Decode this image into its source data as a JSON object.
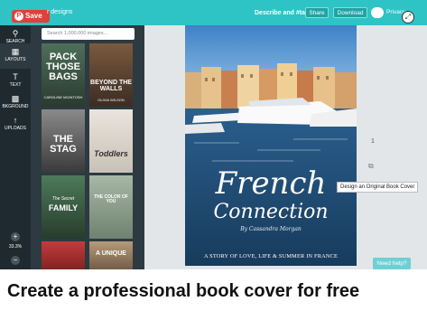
{
  "header": {
    "save_label": "Save",
    "designs_link": "r designs",
    "describe_label": "Describe and #tag",
    "share_label": "Share",
    "download_label": "Download",
    "privacy_label": "Privacy",
    "accent_color": "#2ec4c6",
    "save_color": "#e0403b"
  },
  "sidebar": {
    "items": [
      {
        "label": "SEARCH",
        "icon": "search-icon"
      },
      {
        "label": "LAYOUTS",
        "icon": "layouts-icon"
      },
      {
        "label": "TEXT",
        "icon": "text-icon"
      },
      {
        "label": "BKGROUND",
        "icon": "background-icon"
      },
      {
        "label": "UPLOADS",
        "icon": "upload-icon"
      }
    ],
    "zoom_level": "33.3%"
  },
  "panel": {
    "search_placeholder": "Search 1,000,000 images...",
    "thumbnails": [
      {
        "title": "PACK THOSE BAGS",
        "subtitle": "CAROLINE MCINTOSH"
      },
      {
        "title": "BEYOND THE WALLS",
        "subtitle": "OLIVIA WILSON"
      },
      {
        "title": "THE STAG",
        "subtitle": ""
      },
      {
        "title": "Toddlers",
        "subtitle": ""
      },
      {
        "title": "FAMILY",
        "subtitle": "The Secret"
      },
      {
        "title": "THE COLOR OF YOU",
        "subtitle": ""
      },
      {
        "title": "",
        "subtitle": ""
      },
      {
        "title": "A UNIQUE",
        "subtitle": ""
      }
    ]
  },
  "canvas": {
    "cover_title_line1": "French",
    "cover_title_line2": "Connection",
    "cover_author": "By Cassandra Morgan",
    "cover_tagline": "A STORY OF LOVE, LIFE & SUMMER IN FRANCE",
    "page_number": "1",
    "tooltip": "Design an Original Book Cover",
    "help_label": "Need help?"
  },
  "caption": "Create a professional book cover for free"
}
